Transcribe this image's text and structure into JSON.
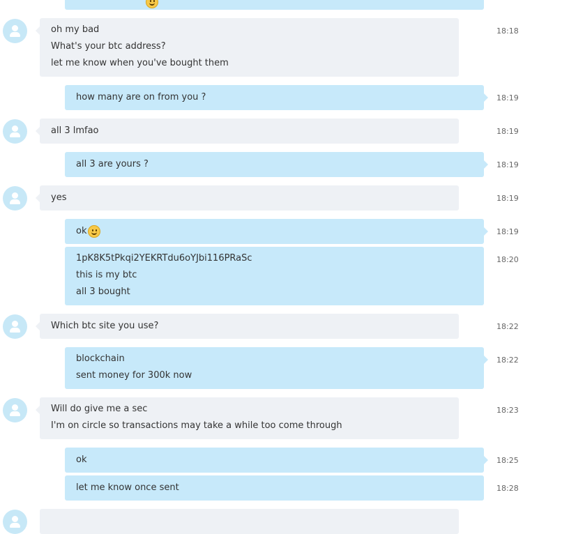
{
  "messages": [
    {
      "id": "top-partial",
      "dir": "out",
      "lines": [],
      "emoji": true,
      "time": ""
    },
    {
      "id": "m1",
      "dir": "in",
      "lines": [
        "oh my bad",
        "What's your btc address?",
        "let me know when you've bought them"
      ],
      "time": "18:18"
    },
    {
      "id": "m2",
      "dir": "out",
      "lines": [
        "how many are on from you ?"
      ],
      "time": "18:19"
    },
    {
      "id": "m3",
      "dir": "in",
      "lines": [
        "all 3 lmfao"
      ],
      "time": "18:19"
    },
    {
      "id": "m4",
      "dir": "out",
      "lines": [
        "all 3 are yours ?"
      ],
      "time": "18:19"
    },
    {
      "id": "m5",
      "dir": "in",
      "lines": [
        "yes"
      ],
      "time": "18:19"
    },
    {
      "id": "m6",
      "dir": "out",
      "lines": [
        "ok"
      ],
      "emoji": true,
      "time": "18:19"
    },
    {
      "id": "m7",
      "dir": "out",
      "lines": [
        "1pK8K5tPkqi2YEKRTdu6oYJbi116PRaSc",
        "this is my btc",
        "all 3 bought"
      ],
      "time": "18:20"
    },
    {
      "id": "m8",
      "dir": "in",
      "lines": [
        "Which btc site you use?"
      ],
      "time": "18:22"
    },
    {
      "id": "m9",
      "dir": "out",
      "lines": [
        "blockchain",
        "sent money for 300k now"
      ],
      "time": "18:22"
    },
    {
      "id": "m10",
      "dir": "in",
      "lines": [
        "Will do give me a sec",
        "I'm on circle so transactions may take a while too come through"
      ],
      "time": "18:23"
    },
    {
      "id": "m11",
      "dir": "out",
      "lines": [
        "ok"
      ],
      "time": "18:25"
    },
    {
      "id": "m12",
      "dir": "out",
      "lines": [
        "let me know once sent"
      ],
      "time": "18:28"
    }
  ],
  "colors": {
    "incoming_bubble": "#eef1f5",
    "outgoing_bubble": "#c7e9fa",
    "avatar": "#c7e8f7",
    "timestamp": "#666666"
  },
  "icons": {
    "avatar": "person-icon",
    "emoji": "smile-emoji-icon"
  }
}
